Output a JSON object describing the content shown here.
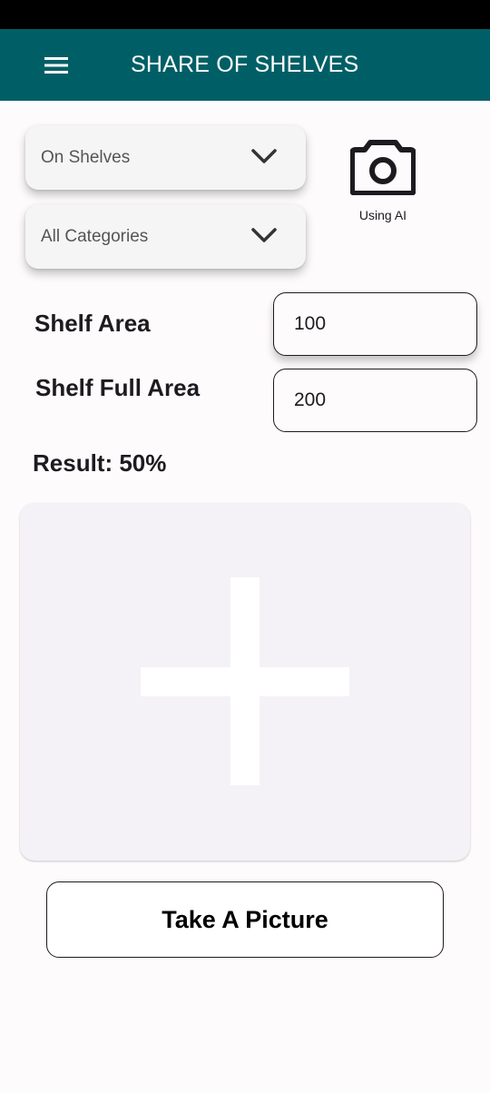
{
  "app_bar": {
    "title": "SHARE OF SHELVES",
    "background": "#005f66",
    "menu_icon": "hamburger-menu-icon"
  },
  "filters": {
    "shelf_type": {
      "selected": "On Shelves",
      "icon": "chevron-down-icon"
    },
    "category": {
      "selected": "All Categories",
      "icon": "chevron-down-icon"
    }
  },
  "camera": {
    "icon": "camera-icon",
    "caption": "Using AI"
  },
  "fields": {
    "shelf_area": {
      "label": "Shelf Area",
      "value": "100"
    },
    "shelf_full_area": {
      "label": "Shelf Full Area",
      "value": "200"
    }
  },
  "result": {
    "text": "Result: 50%"
  },
  "image_picker": {
    "icon": "plus-icon"
  },
  "actions": {
    "take_picture_label": "Take A Picture"
  }
}
